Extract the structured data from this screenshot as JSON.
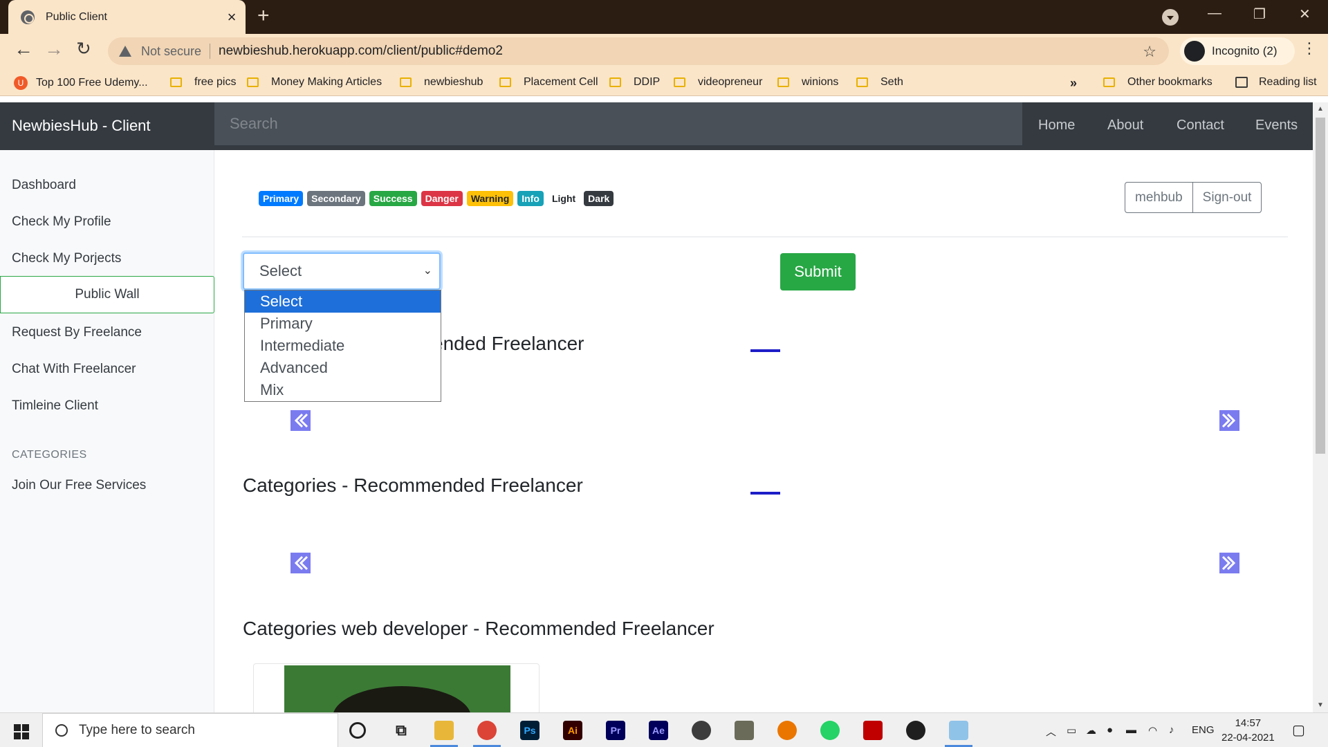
{
  "browser": {
    "tab_title": "Public Client",
    "new_tab": "+",
    "window_controls": {
      "minimize": "—",
      "restore": "❐",
      "close": "✕"
    },
    "security_label": "Not secure",
    "url": "newbieshub.herokuapp.com/client/public#demo2",
    "incognito_label": "Incognito (2)",
    "bookmarks": [
      "Top 100 Free Udemy...",
      "free pics",
      "Money Making Articles",
      "newbieshub",
      "Placement Cell",
      "DDIP",
      "videopreneur",
      "winions",
      "Seth"
    ],
    "bookmarks_overflow": "»",
    "other_bookmarks": "Other bookmarks",
    "reading_list": "Reading list"
  },
  "navbar": {
    "brand": "NewbiesHub - Client",
    "search_placeholder": "Search",
    "links": [
      "Home",
      "About",
      "Contact",
      "Events"
    ]
  },
  "sidebar": {
    "items": [
      "Dashboard",
      "Check My Profile",
      "Check My Porjects"
    ],
    "active_item": "Public Wall",
    "items_after": [
      "Request By Freelance",
      "Chat With Freelancer",
      "Timleine Client"
    ],
    "categories_heading": "CATEGORIES",
    "category_items": [
      "Join Our Free Services"
    ]
  },
  "badges": [
    {
      "label": "Primary",
      "color": "#007bff"
    },
    {
      "label": "Secondary",
      "color": "#6c757d"
    },
    {
      "label": "Success",
      "color": "#28a745"
    },
    {
      "label": "Danger",
      "color": "#dc3545"
    },
    {
      "label": "Warning",
      "color": "#ffc107"
    },
    {
      "label": "Info",
      "color": "#17a2b8"
    },
    {
      "label": "Light",
      "color": "#f8f9fa"
    },
    {
      "label": "Dark",
      "color": "#343a40"
    }
  ],
  "user": {
    "username": "mehbub",
    "signout": "Sign-out"
  },
  "level_select": {
    "value": "Select",
    "options": [
      "Select",
      "Primary",
      "Intermediate",
      "Advanced",
      "Mix"
    ],
    "highlighted": "Select"
  },
  "submit_label": "Submit",
  "sections": [
    {
      "title_visible": "ended Freelancer"
    },
    {
      "title": "Categories - Recommended Freelancer"
    },
    {
      "title": "Categories web developer - Recommended Freelancer"
    }
  ],
  "taskbar": {
    "search_placeholder": "Type here to search",
    "apps": [
      "cortana",
      "task-view",
      "file-explorer",
      "chrome",
      "photoshop",
      "illustrator",
      "premiere",
      "after-effects",
      "inkscape",
      "gimp",
      "blender",
      "whatsapp",
      "app-red",
      "xbox",
      "app-blue"
    ],
    "language": "ENG",
    "time": "14:57",
    "date": "22-04-2021"
  },
  "colors": {
    "navbar_bg": "#343a40",
    "success": "#28a745",
    "carousel_indicator": "#1d1dc8",
    "carousel_arrow": "#7b7bf0",
    "select_highlight": "#1e6fd9"
  }
}
